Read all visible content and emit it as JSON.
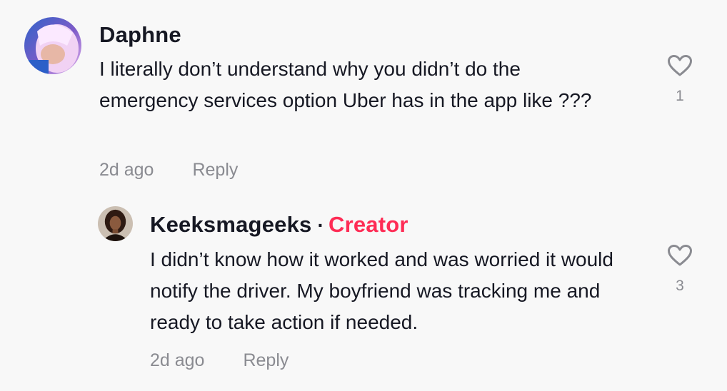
{
  "comments": [
    {
      "username": "Daphne",
      "text": "I literally don’t understand why you didn’t do the emergency services option Uber has in the app like ???",
      "time": "2d ago",
      "reply_label": "Reply",
      "likes": "1",
      "avatar_colors": [
        "#d9a6e8",
        "#3b6fd1"
      ]
    }
  ],
  "replies": [
    {
      "username": "Keeksmageeks",
      "separator": "·",
      "badge": "Creator",
      "text": "I didn’t know how it worked and was worried it would notify the driver. My boyfriend was tracking me and ready to take action if needed.",
      "time": "2d ago",
      "reply_label": "Reply",
      "likes": "3",
      "avatar_colors": [
        "#c9b9a7",
        "#3a2418"
      ]
    }
  ],
  "colors": {
    "background": "#f8f8f8",
    "text": "#161823",
    "muted": "#8a8b91",
    "creator": "#fe2c55"
  },
  "icons": [
    "heart-outline-icon"
  ]
}
